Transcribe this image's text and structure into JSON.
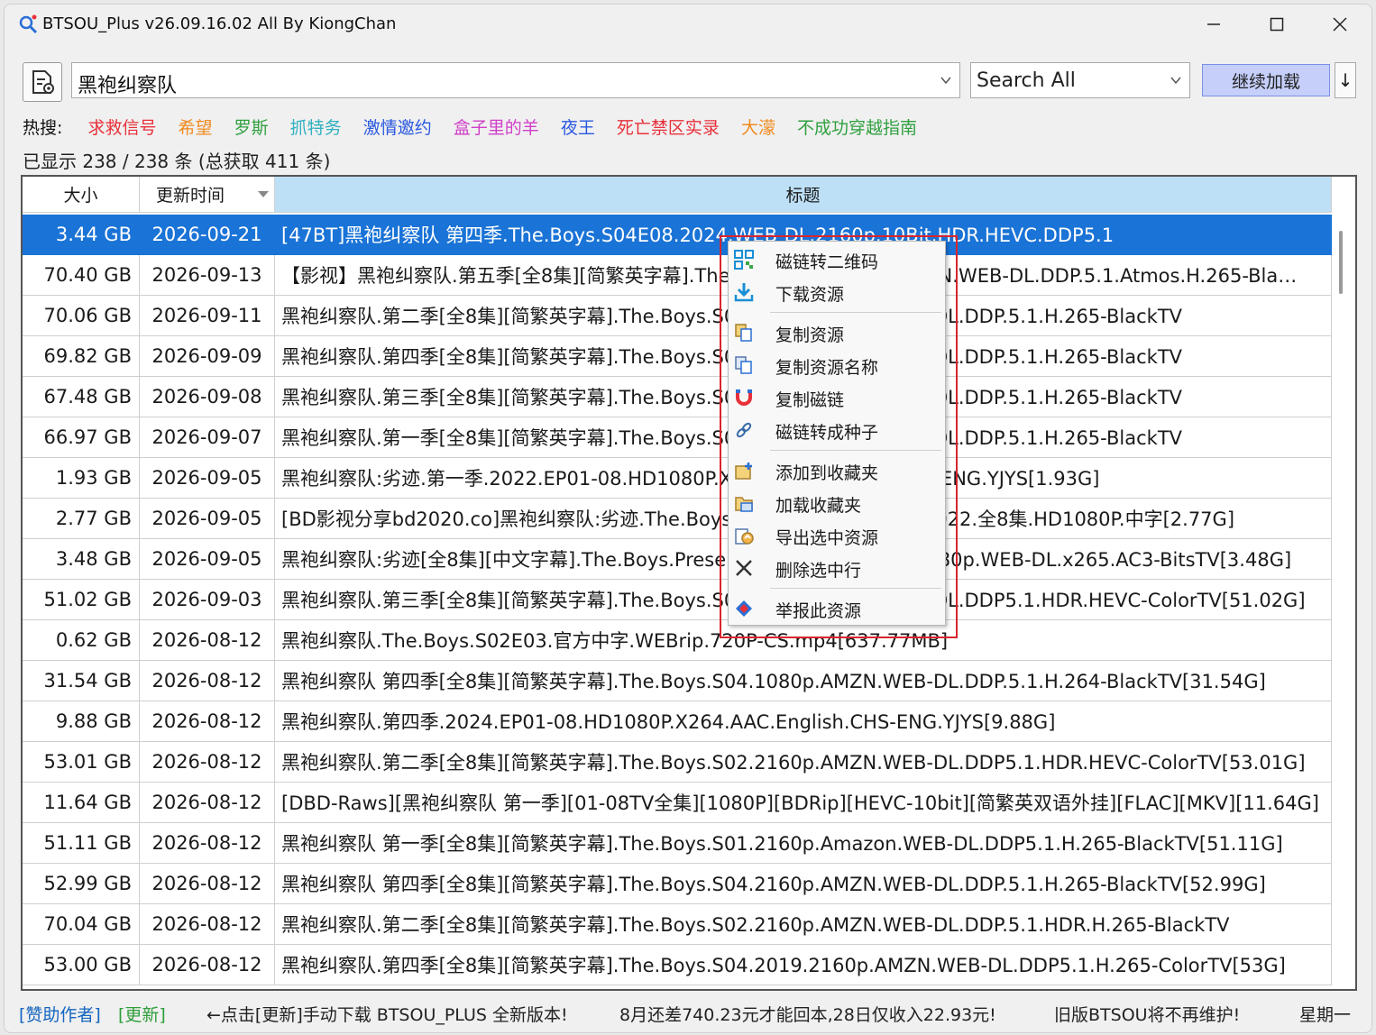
{
  "window": {
    "title": "BTSOU_Plus v26.09.16.02 All By KiongChan",
    "minimize": "—",
    "maximize": "☐",
    "close": "✕"
  },
  "search": {
    "query": "黑袍纠察队",
    "scope": "Search All",
    "load_label": "继续加载",
    "down_label": "↓"
  },
  "hot": {
    "label": "热搜:",
    "items": [
      {
        "text": "求救信号",
        "color": "#e8303a"
      },
      {
        "text": "希望",
        "color": "#f08a20"
      },
      {
        "text": "罗斯",
        "color": "#30a040"
      },
      {
        "text": "抓特务",
        "color": "#30b0c0"
      },
      {
        "text": "激情邀约",
        "color": "#2a58e0"
      },
      {
        "text": "盒子里的羊",
        "color": "#d040c8"
      },
      {
        "text": "夜王",
        "color": "#2a58e0"
      },
      {
        "text": "死亡禁区实录",
        "color": "#e8303a"
      },
      {
        "text": "大濛",
        "color": "#f08a20"
      },
      {
        "text": "不成功穿越指南",
        "color": "#30a040"
      }
    ]
  },
  "count_text": "已显示 238 / 238 条 (总获取 411 条)",
  "table": {
    "headers": {
      "size": "大小",
      "date": "更新时间",
      "title": "标题"
    },
    "rows": [
      {
        "size": "3.44 GB",
        "date": "2026-09-21",
        "title": "[47BT]黑袍纠察队 第四季.The.Boys.S04E08.2024.WEB-DL.2160p.10Bit.HDR.HEVC.DDP5.1"
      },
      {
        "size": "70.40 GB",
        "date": "2026-09-13",
        "title": "【影视】黑袍纠察队.第五季[全8集][简繁英字幕].The.Boys.S05.2160p.AMZN.WEB-DL.DDP.5.1.Atmos.H.265-Bla…"
      },
      {
        "size": "70.06 GB",
        "date": "2026-09-11",
        "title": "黑袍纠察队.第二季[全8集][简繁英字幕].The.Boys.S02.2160p.AMZN.WEB-DL.DDP.5.1.H.265-BlackTV"
      },
      {
        "size": "69.82 GB",
        "date": "2026-09-09",
        "title": "黑袍纠察队.第四季[全8集][简繁英字幕].The.Boys.S04.2160p.AMZN.WEB-DL.DDP.5.1.H.265-BlackTV"
      },
      {
        "size": "67.48 GB",
        "date": "2026-09-08",
        "title": "黑袍纠察队.第三季[全8集][简繁英字幕].The.Boys.S03.2160p.AMZN.WEB-DL.DDP.5.1.H.265-BlackTV"
      },
      {
        "size": "66.97 GB",
        "date": "2026-09-07",
        "title": "黑袍纠察队.第一季[全8集][简繁英字幕].The.Boys.S01.2160p.AMZN.WEB-DL.DDP.5.1.H.265-BlackTV"
      },
      {
        "size": "1.93 GB",
        "date": "2026-09-05",
        "title": "黑袍纠察队:劣迹.第一季.2022.EP01-08.HD1080P.X264.AAC.English.CHS-ENG.YJYS[1.93G]"
      },
      {
        "size": "2.77 GB",
        "date": "2026-09-05",
        "title": "[BD影视分享bd2020.co]黑袍纠察队:劣迹.The.Boys.Presents.Diabolical.2022.全8集.HD1080P.中字[2.77G]"
      },
      {
        "size": "3.48 GB",
        "date": "2026-09-05",
        "title": "黑袍纠察队:劣迹[全8集][中文字幕].The.Boys.Presents.Diabolical.2022.1080p.WEB-DL.x265.AC3-BitsTV[3.48G]"
      },
      {
        "size": "51.02 GB",
        "date": "2026-09-03",
        "title": "黑袍纠察队.第三季[全8集][简繁英字幕].The.Boys.S03.2160p.AMZN.WEB-DL.DDP5.1.HDR.HEVC-ColorTV[51.02G]"
      },
      {
        "size": "0.62 GB",
        "date": "2026-08-12",
        "title": "黑袍纠察队.The.Boys.S02E03.官方中字.WEBrip.720P-CS.mp4[637.77MB]"
      },
      {
        "size": "31.54 GB",
        "date": "2026-08-12",
        "title": "黑袍纠察队 第四季[全8集][简繁英字幕].The.Boys.S04.1080p.AMZN.WEB-DL.DDP.5.1.H.264-BlackTV[31.54G]"
      },
      {
        "size": "9.88 GB",
        "date": "2026-08-12",
        "title": "黑袍纠察队.第四季.2024.EP01-08.HD1080P.X264.AAC.English.CHS-ENG.YJYS[9.88G]"
      },
      {
        "size": "53.01 GB",
        "date": "2026-08-12",
        "title": "黑袍纠察队.第二季[全8集][简繁英字幕].The.Boys.S02.2160p.AMZN.WEB-DL.DDP5.1.HDR.HEVC-ColorTV[53.01G]"
      },
      {
        "size": "11.64 GB",
        "date": "2026-08-12",
        "title": "[DBD-Raws][黑袍纠察队 第一季][01-08TV全集][1080P][BDRip][HEVC-10bit][简繁英双语外挂][FLAC][MKV][11.64G]"
      },
      {
        "size": "51.11 GB",
        "date": "2026-08-12",
        "title": "黑袍纠察队 第一季[全8集][简繁英字幕].The.Boys.S01.2160p.Amazon.WEB-DL.DDP5.1.H.265-BlackTV[51.11G]"
      },
      {
        "size": "52.99 GB",
        "date": "2026-08-12",
        "title": "黑袍纠察队 第四季[全8集][简繁英字幕].The.Boys.S04.2160p.AMZN.WEB-DL.DDP.5.1.H.265-BlackTV[52.99G]"
      },
      {
        "size": "70.04 GB",
        "date": "2026-08-12",
        "title": "黑袍纠察队.第二季[全8集][简繁英字幕].The.Boys.S02.2160p.AMZN.WEB-DL.DDP.5.1.HDR.H.265-BlackTV"
      },
      {
        "size": "53.00 GB",
        "date": "2026-08-12",
        "title": "黑袍纠察队.第四季[全8集][简繁英字幕].The.Boys.S04.2019.2160p.AMZN.WEB-DL.DDP5.1.H.265-ColorTV[53G]"
      }
    ]
  },
  "context_menu": {
    "items": [
      {
        "label": "磁链转二维码",
        "icon": "qr-code-icon"
      },
      {
        "label": "下载资源",
        "icon": "download-icon"
      },
      {
        "label": "复制资源",
        "icon": "copy-icon"
      },
      {
        "label": "复制资源名称",
        "icon": "copy-name-icon"
      },
      {
        "label": "复制磁链",
        "icon": "magnet-icon"
      },
      {
        "label": "磁链转成种子",
        "icon": "link-icon"
      },
      {
        "label": "添加到收藏夹",
        "icon": "favorite-add-icon"
      },
      {
        "label": "加载收藏夹",
        "icon": "favorite-load-icon"
      },
      {
        "label": "导出选中资源",
        "icon": "export-icon"
      },
      {
        "label": "删除选中行",
        "icon": "delete-icon"
      },
      {
        "label": "举报此资源",
        "icon": "report-icon"
      }
    ]
  },
  "status": {
    "sponsor": "[赞助作者]",
    "update": "[更新]",
    "msg1": "←点击[更新]手动下载 BTSOU_PLUS 全新版本!",
    "msg2": "8月还差740.23元才能回本,28日仅收入22.93元!",
    "msg3": "旧版BTSOU将不再维护!",
    "weekday": "星期一"
  },
  "colors": {
    "selection": "#1a73d6",
    "header_title_bg": "#bde0f7",
    "button_bg": "#c5cffa",
    "link": "#1565c0",
    "green": "#2e9e3a",
    "highlight_border": "#d9252c"
  }
}
